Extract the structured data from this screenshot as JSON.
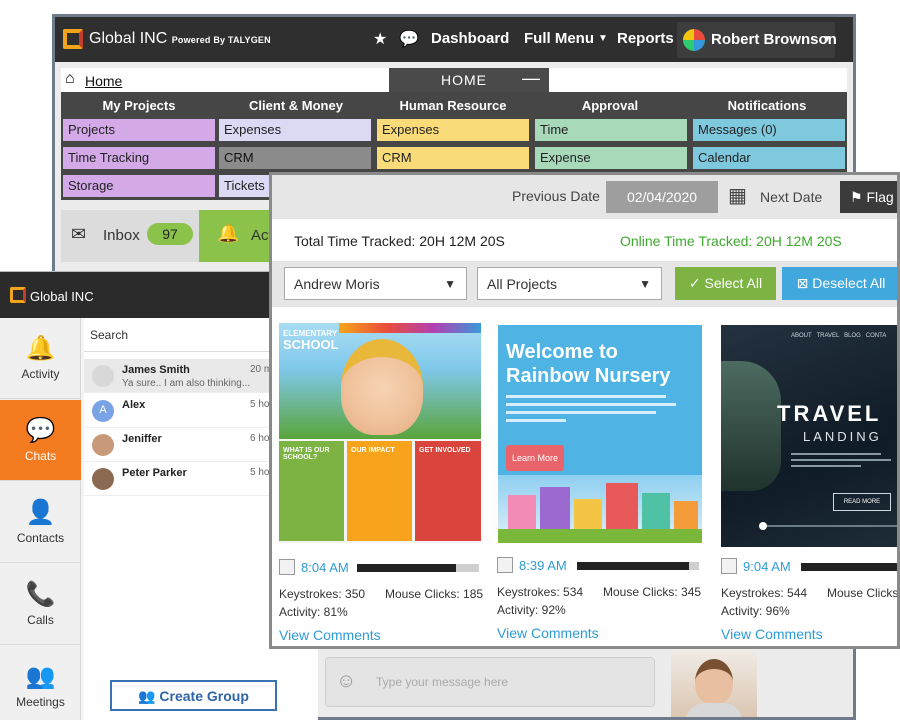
{
  "back_window": {
    "brand": "Global INC",
    "brand_sub": "Powered By TALYGEN",
    "nav": [
      "Dashboard",
      "Full Menu",
      "Reports"
    ],
    "user": "Robert Brownson",
    "breadcrumb": "Home",
    "home_tab": "HOME",
    "columns": [
      {
        "title": "My Projects",
        "items": [
          "Projects",
          "Time Tracking",
          "Storage"
        ]
      },
      {
        "title": "Client & Money",
        "items": [
          "Expenses",
          "CRM",
          "Tickets"
        ]
      },
      {
        "title": "Human Resource",
        "items": [
          "Expenses",
          "CRM",
          ""
        ]
      },
      {
        "title": "Approval",
        "items": [
          "Time",
          "Expense",
          ""
        ]
      },
      {
        "title": "Notifications",
        "items": [
          "Messages (0)",
          "Calendar",
          ""
        ]
      }
    ],
    "inbox_label": "Inbox",
    "inbox_count": "97",
    "activity_label": "Act",
    "message_placeholder": "Type your message here"
  },
  "chat": {
    "brand": "Global INC",
    "sidebar": [
      "Activity",
      "Chats",
      "Contacts",
      "Calls",
      "Meetings"
    ],
    "search_placeholder": "Search",
    "contacts": [
      {
        "name": "James Smith",
        "snippet": "Ya sure.. I am also thinking...",
        "time": "20 m",
        "initial": ""
      },
      {
        "name": "Alex",
        "snippet": "",
        "time": "5 ho",
        "initial": "A"
      },
      {
        "name": "Jeniffer",
        "snippet": "",
        "time": "6 ho",
        "initial": ""
      },
      {
        "name": "Peter Parker",
        "snippet": "",
        "time": "5 ho",
        "initial": ""
      }
    ],
    "create_group": "Create Group"
  },
  "monitor": {
    "prev_date_label": "Previous Date",
    "date": "02/04/2020",
    "next_date_label": "Next Date",
    "flag_label": "Flag",
    "total_time": "Total Time Tracked: 20H 12M 20S",
    "online_time": "Online Time Tracked: 20H 12M 20S",
    "user_select": "Andrew Moris",
    "project_select": "All Projects",
    "select_all": "Select All",
    "deselect_all": "Deselect All",
    "shots": [
      {
        "time": "8:04 AM",
        "keystrokes": "Keystrokes: 350",
        "clicks": "Mouse Clicks: 185",
        "activity": "Activity: 81%",
        "activity_level": 0.81,
        "view": "View Comments"
      },
      {
        "time": "8:39 AM",
        "keystrokes": "Keystrokes: 534",
        "clicks": "Mouse Clicks: 345",
        "activity": "Activity: 92%",
        "activity_level": 0.92,
        "view": "View Comments"
      },
      {
        "time": "9:04 AM",
        "keystrokes": "Keystrokes: 544",
        "clicks": "Mouse Clicks",
        "activity": "Activity: 96%",
        "activity_level": 0.96,
        "view": "View Comments"
      }
    ],
    "shot1": {
      "title_line1": "ELEMENTARY",
      "title_line2": "SCHOOL",
      "box1": "WHAT IS OUR SCHOOL?",
      "box2": "OUR IMPACT",
      "box3": "GET INVOLVED"
    },
    "shot2": {
      "headline1": "Welcome to",
      "headline2": "Rainbow Nursery",
      "button": "Learn More"
    },
    "shot3": {
      "nav": "ABOUT   TRAVEL   BLOG   CONTA",
      "headline": "TRAVEL",
      "sub": "LANDING",
      "button": "READ MORE"
    }
  },
  "colors": {
    "accent_orange": "#f47b20",
    "select_green": "#7cb342",
    "deselect_blue": "#40a8dc",
    "link_blue": "#2e9bd6"
  }
}
